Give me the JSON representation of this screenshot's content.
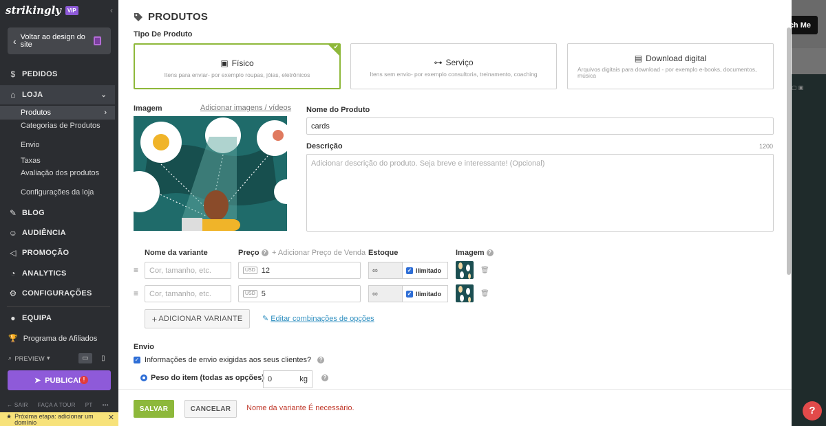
{
  "sidebar": {
    "logo": "strikingly",
    "vip_badge": "VIP",
    "back_label": "Voltar ao design do site",
    "nav": {
      "pedidos": "PEDIDOS",
      "loja": "LOJA",
      "blog": "BLOG",
      "audiencia": "AUDIÊNCIA",
      "promocao": "PROMOÇÃO",
      "analytics": "ANALYTICS",
      "configuracoes": "CONFIGURAÇÕES",
      "equipa": "EQUIPA"
    },
    "loja_sub": {
      "produtos": "Produtos",
      "categorias": "Categorias de Produtos",
      "envio": "Envio",
      "taxas": "Taxas",
      "avaliacao": "Avaliação dos produtos",
      "config_loja": "Configurações da loja"
    },
    "affiliates": "Programa de Afiliados",
    "preview": "PREVIEW",
    "publish": "PUBLICAR",
    "publish_alert": "!",
    "bottom": {
      "exit": "SAIR",
      "tour": "FAÇA A TOUR",
      "lang": "PT",
      "more": "•••"
    },
    "next_step": "Próxima etapa: adicionar um domínio"
  },
  "panel": {
    "title": "PRODUTOS",
    "product_type_label": "Tipo De Produto",
    "types": [
      {
        "title": "Físico",
        "desc": "Itens para enviar- por exemplo roupas, jóias, eletrônicos",
        "icon": "box-icon"
      },
      {
        "title": "Serviço",
        "desc": "Itens sem envio- por exemplo consultoria, treinamento, coaching",
        "icon": "dumbbell-icon"
      },
      {
        "title": "Download digital",
        "desc": "Arquivos digitais para download - por exemplo e-books, documentos, música",
        "icon": "document-icon"
      }
    ],
    "image_label": "Imagem",
    "add_images_link": "Adicionar imagens / vídeos",
    "name_label": "Nome do Produto",
    "name_value": "cards",
    "description_label": "Descrição",
    "description_placeholder": "Adicionar descrição do produto. Seja breve e interessante! (Opcional)",
    "description_counter": "1200",
    "variants": {
      "headers": {
        "name": "Nome da variante",
        "price": "Preço",
        "add_sale_price": "+ Adicionar Preço de Venda",
        "stock": "Estoque",
        "image": "Imagem"
      },
      "name_placeholder": "Cor, tamanho, etc.",
      "currency": "USD",
      "unlimited_value": "∞",
      "unlimited_label": "Ilimitado",
      "rows": [
        {
          "price": "12"
        },
        {
          "price": "5"
        }
      ],
      "add_variant": "ADICIONAR VARIANTE",
      "edit_combos": "Editar combinações de opções"
    },
    "shipping": {
      "label": "Envio",
      "required_info": "Informações de envio exigidas aos seus clientes?",
      "weight_label": "Peso do item (todas as opções)",
      "weight_value": "0",
      "weight_unit": "kg"
    },
    "footer": {
      "save": "SALVAR",
      "cancel": "CANCELAR",
      "error": "Nome da variante É necessário."
    }
  },
  "background": {
    "touch_button": "ch Me",
    "help": "?"
  },
  "colors": {
    "accent_green": "#8db83b",
    "publish_purple": "#8e5ad9",
    "error_red": "#c0392b",
    "link_blue": "#2f8fc0"
  }
}
